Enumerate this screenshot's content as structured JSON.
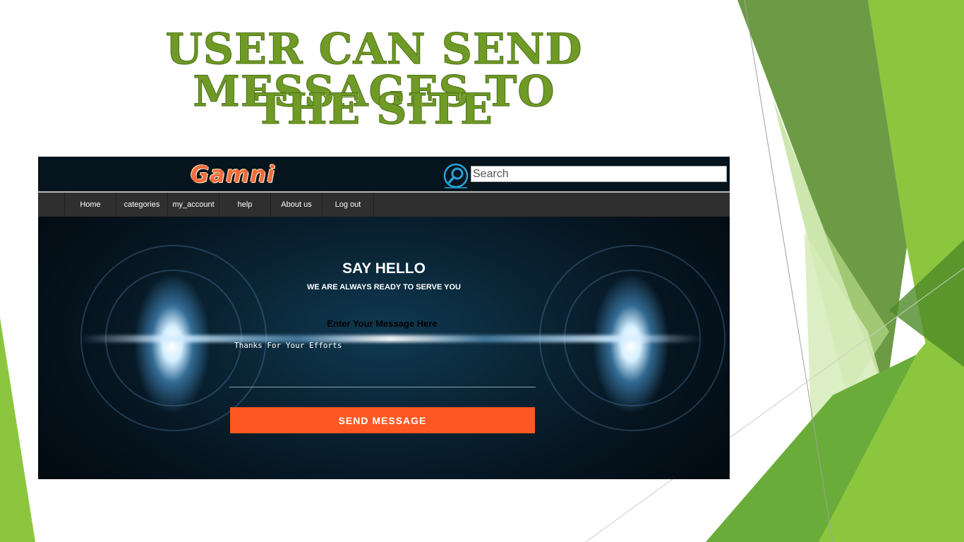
{
  "slide": {
    "title_line1": "User can send messages to",
    "title_line2": "the site",
    "accent_colors": [
      "#6f9a26",
      "#8cc63f",
      "#6a9a3a",
      "#d6ebb8"
    ]
  },
  "app": {
    "logo": "Gamni",
    "search": {
      "placeholder": "Search",
      "value": ""
    },
    "nav": [
      {
        "label": "Home"
      },
      {
        "label": "categories"
      },
      {
        "label": "my_account"
      },
      {
        "label": "help"
      },
      {
        "label": "About us"
      },
      {
        "label": "Log out"
      }
    ],
    "hero": {
      "heading": "SAY HELLO",
      "subheading": "WE ARE ALWAYS READY TO SERVE YOU"
    },
    "form": {
      "label": "Enter Your Message Here",
      "message_value": "Thanks For Your Efforts",
      "submit_label": "SEND MESSAGE",
      "submit_color": "#fe5722"
    }
  }
}
